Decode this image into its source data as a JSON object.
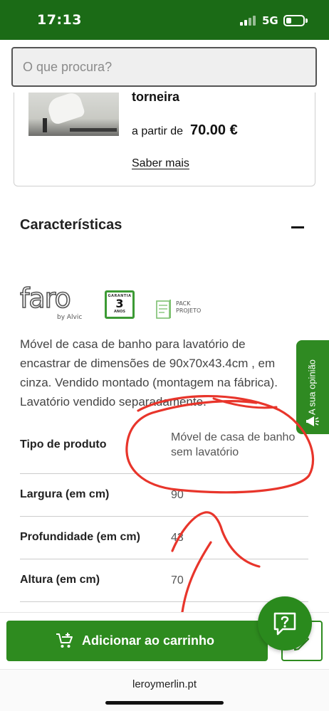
{
  "status_bar": {
    "time": "17:13",
    "network": "5G"
  },
  "search": {
    "placeholder": "O que procura?"
  },
  "promo_card": {
    "title": "torneira",
    "price_prefix": "a partir de",
    "price": "70.00 €",
    "link_label": "Saber mais"
  },
  "characteristics": {
    "title": "Características",
    "badges": {
      "brand": "faro",
      "brand_by": "by Alvic",
      "warranty_top": "GARANTIA",
      "warranty_years": "3",
      "warranty_bottom": "ANOS",
      "pack_line1": "PACK",
      "pack_line2": "PROJETO"
    },
    "description": "Móvel de casa de banho para lavatório de encastrar de dimensões de 90x70x43.4cm , em cinza. Vendido montado (montagem na fábrica). Lavatório vendido separadamente.",
    "specs": [
      {
        "key": "Tipo de produto",
        "value": "Móvel de casa de banho sem lavatório"
      },
      {
        "key": "Largura (em cm)",
        "value": "90"
      },
      {
        "key": "Profundidade (em cm)",
        "value": "43"
      },
      {
        "key": "Altura (em cm)",
        "value": "70"
      }
    ]
  },
  "feedback_tab": {
    "label": "A sua opinião"
  },
  "cart": {
    "button_label": "Adicionar ao carrinho"
  },
  "browser": {
    "url": "leroymerlin.pt"
  },
  "colors": {
    "brand_green": "#2e8b1f",
    "status_green": "#1b6b16",
    "annotation_red": "#e8352b"
  }
}
